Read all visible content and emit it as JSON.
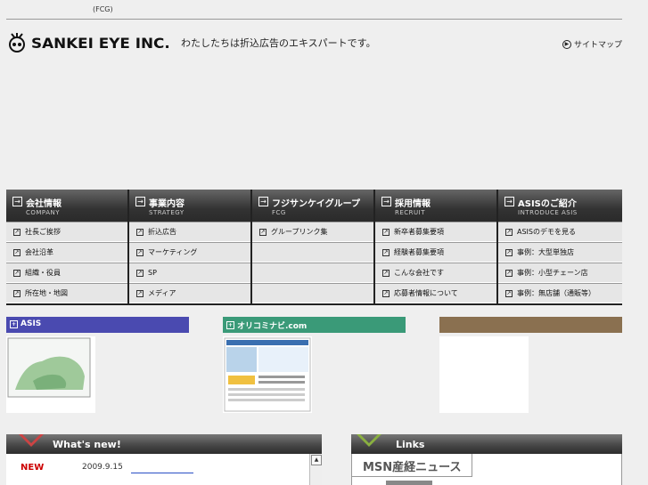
{
  "topbar": {
    "fcg": "(FCG)"
  },
  "header": {
    "logo_text": "SANKEI EYE INC.",
    "tagline": "わたしたちは折込広告のエキスパートです。",
    "sitemap": "サイトマップ"
  },
  "nav": [
    {
      "jp": "会社情報",
      "en": "COMPANY",
      "items": [
        "社長ご挨拶",
        "会社沿革",
        "組織・役員",
        "所在地・地図"
      ]
    },
    {
      "jp": "事業内容",
      "en": "STRATEGY",
      "items": [
        "折込広告",
        "マーケティング",
        "SP",
        "メディア"
      ]
    },
    {
      "jp": "フジサンケイグループ",
      "en": "FCG",
      "items": [
        "グループリンク集",
        "",
        "",
        ""
      ]
    },
    {
      "jp": "採用情報",
      "en": "RECRUIT",
      "items": [
        "新卒者募集要項",
        "経験者募集要項",
        "こんな会社です",
        "応募者情報について"
      ]
    },
    {
      "jp": "ASISのご紹介",
      "en": "INTRODUCE ASIS",
      "items": [
        "ASISのデモを見る",
        "事例：大型単独店",
        "事例：小型チェーン店",
        "事例：無店舗（通販等）"
      ]
    }
  ],
  "banners": {
    "asis": "ASIS",
    "orikomi": "オリコミナビ.com"
  },
  "news": {
    "title": "What's new!",
    "tag": "NEW",
    "date": "2009.9.15"
  },
  "links": {
    "title": "Links",
    "msn": "MSN産経ニュース"
  },
  "colors": {
    "asis_banner": "#4a4ab0",
    "orikomi_banner": "#3a9a78",
    "brown_banner": "#8a7050"
  }
}
